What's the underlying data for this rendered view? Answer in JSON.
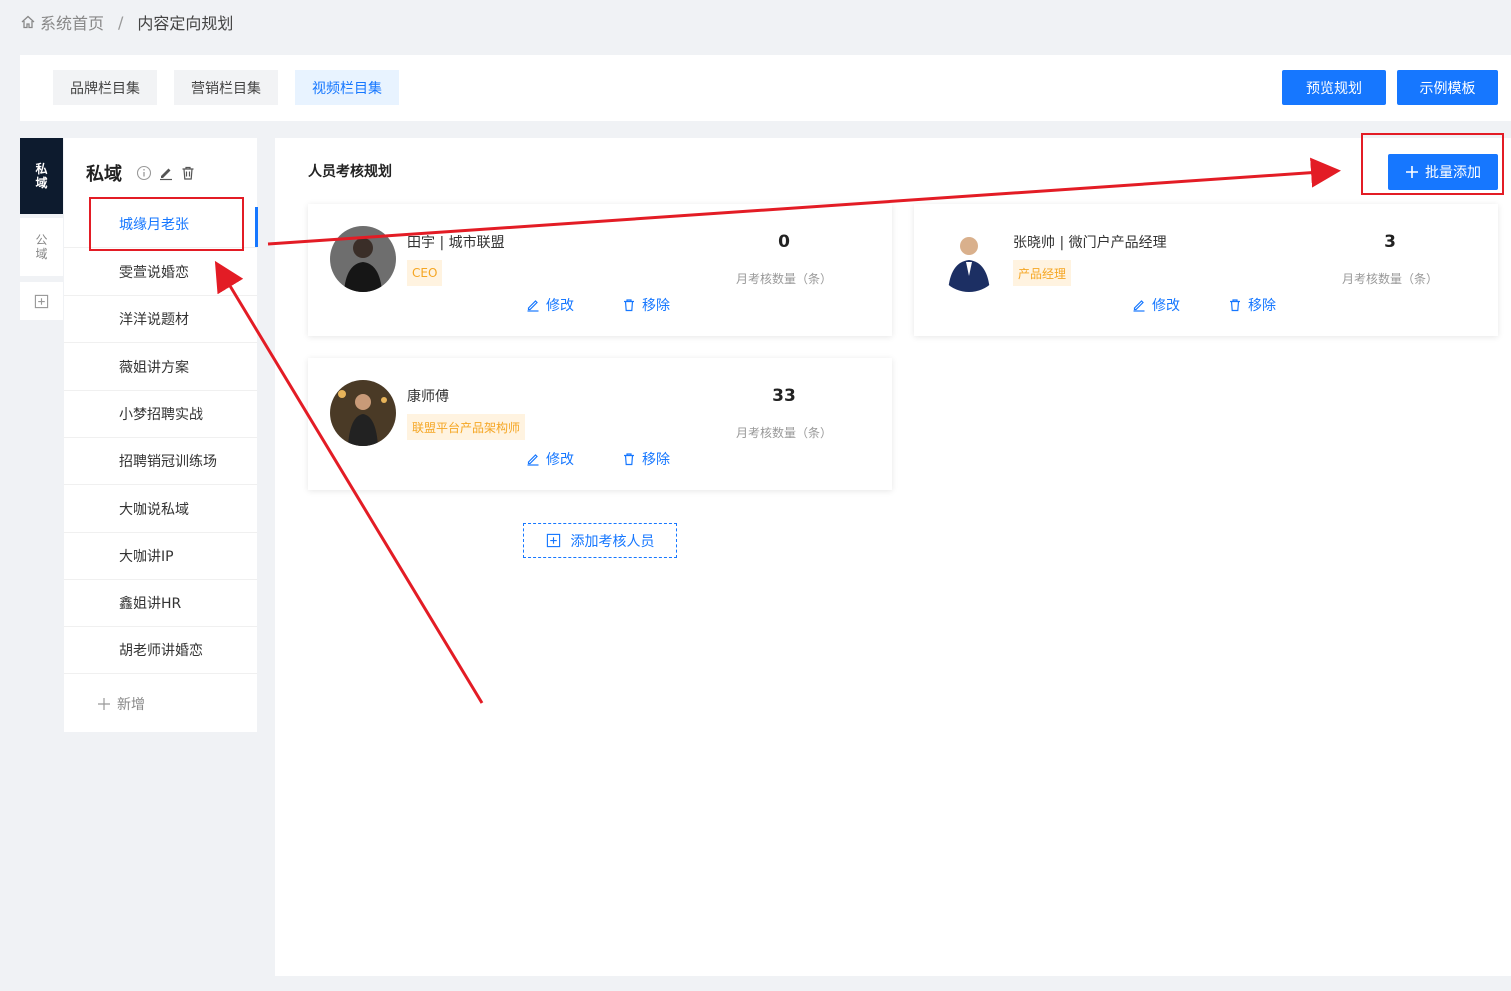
{
  "breadcrumb": {
    "home": "系统首页",
    "separator": "/",
    "current": "内容定向规划"
  },
  "topbar": {
    "tabs": [
      {
        "label": "品牌栏目集",
        "active": false
      },
      {
        "label": "营销栏目集",
        "active": false
      },
      {
        "label": "视频栏目集",
        "active": true
      }
    ],
    "preview_label": "预览规划",
    "template_label": "示例模板"
  },
  "domain_tabs": {
    "private": "私域",
    "public": "公域"
  },
  "list": {
    "title": "私域",
    "items": [
      "城缘月老张",
      "雯萱说婚恋",
      "洋洋说题材",
      "薇姐讲方案",
      "小梦招聘实战",
      "招聘销冠训练场",
      "大咖说私域",
      "大咖讲IP",
      "鑫姐讲HR",
      "胡老师讲婚恋"
    ],
    "active_index": 0,
    "add_label": "新增"
  },
  "main": {
    "title": "人员考核规划",
    "batch_add_label": "批量添加",
    "add_person_label": "添加考核人员",
    "cards": [
      {
        "name": "田宇 | 城市联盟",
        "tag": "CEO",
        "count": "0",
        "count_label": "月考核数量（条）",
        "edit": "修改",
        "remove": "移除"
      },
      {
        "name": "张晓帅 | 微门户产品经理",
        "tag": "产品经理",
        "count": "3",
        "count_label": "月考核数量（条）",
        "edit": "修改",
        "remove": "移除"
      },
      {
        "name": "康师傅",
        "tag": "联盟平台产品架构师",
        "count": "33",
        "count_label": "月考核数量（条）",
        "edit": "修改",
        "remove": "移除"
      }
    ]
  },
  "colors": {
    "primary": "#1677ff",
    "dark_tab": "#0d1b2e",
    "tag_bg": "#fff3e0",
    "tag_text": "#f5a623",
    "annotation": "#e31c25"
  },
  "icons": [
    "home-icon",
    "info-icon",
    "edit-icon",
    "trash-icon",
    "plus-icon",
    "plus-square-icon"
  ]
}
